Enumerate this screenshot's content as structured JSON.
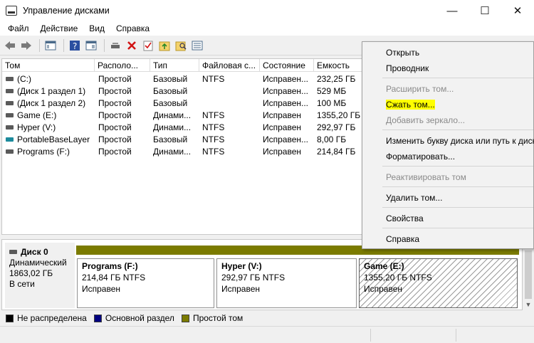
{
  "window": {
    "title": "Управление дисками",
    "minimize": "—",
    "maximize": "☐",
    "close": "✕"
  },
  "menu": [
    "Файл",
    "Действие",
    "Вид",
    "Справка"
  ],
  "table": {
    "headers": [
      "Том",
      "Располо...",
      "Тип",
      "Файловая с...",
      "Состояние",
      "Емкость"
    ],
    "rows": [
      {
        "name": "(C:)",
        "layout": "Простой",
        "type": "Базовый",
        "fs": "NTFS",
        "status": "Исправен...",
        "capacity": "232,25 ГБ",
        "icon": "drive-icon"
      },
      {
        "name": "(Диск 1 раздел 1)",
        "layout": "Простой",
        "type": "Базовый",
        "fs": "",
        "status": "Исправен...",
        "capacity": "529 МБ",
        "icon": "drive-icon"
      },
      {
        "name": "(Диск 1 раздел 2)",
        "layout": "Простой",
        "type": "Базовый",
        "fs": "",
        "status": "Исправен...",
        "capacity": "100 МБ",
        "icon": "drive-icon"
      },
      {
        "name": "Game (E:)",
        "layout": "Простой",
        "type": "Динами...",
        "fs": "NTFS",
        "status": "Исправен",
        "capacity": "1355,20 ГБ",
        "icon": "drive-icon"
      },
      {
        "name": "Hyper (V:)",
        "layout": "Простой",
        "type": "Динами...",
        "fs": "NTFS",
        "status": "Исправен",
        "capacity": "292,97 ГБ",
        "icon": "drive-icon"
      },
      {
        "name": "PortableBaseLayer",
        "layout": "Простой",
        "type": "Базовый",
        "fs": "NTFS",
        "status": "Исправен...",
        "capacity": "8,00 ГБ",
        "icon": "vhd-icon"
      },
      {
        "name": "Programs (F:)",
        "layout": "Простой",
        "type": "Динами...",
        "fs": "NTFS",
        "status": "Исправен",
        "capacity": "214,84 ГБ",
        "icon": "drive-icon"
      }
    ]
  },
  "context_menu": [
    {
      "label": "Открыть",
      "disabled": false
    },
    {
      "label": "Проводник",
      "disabled": false
    },
    {
      "label": "Расширить том...",
      "disabled": true
    },
    {
      "label": "Сжать том...",
      "disabled": false,
      "highlight": true
    },
    {
      "label": "Добавить зеркало...",
      "disabled": true
    },
    {
      "label": "Изменить букву диска или путь к диску...",
      "disabled": false
    },
    {
      "label": "Форматировать...",
      "disabled": false
    },
    {
      "label": "Реактивировать том",
      "disabled": true
    },
    {
      "label": "Удалить том...",
      "disabled": false
    },
    {
      "label": "Свойства",
      "disabled": false
    },
    {
      "label": "Справка",
      "disabled": false
    }
  ],
  "disk": {
    "name": "Диск 0",
    "type": "Динамический",
    "size": "1863,02 ГБ",
    "status": "В сети",
    "partitions": [
      {
        "name": "Programs  (F:)",
        "size": "214,84 ГБ NTFS",
        "status": "Исправен",
        "selected": false
      },
      {
        "name": "Hyper  (V:)",
        "size": "292,97 ГБ NTFS",
        "status": "Исправен",
        "selected": false
      },
      {
        "name": "Game  (E:)",
        "size": "1355,20 ГБ NTFS",
        "status": "Исправен",
        "selected": true
      }
    ]
  },
  "legend": [
    {
      "label": "Не распределена",
      "color": "#000000"
    },
    {
      "label": "Основной раздел",
      "color": "#000080"
    },
    {
      "label": "Простой том",
      "color": "#7b7b00"
    }
  ],
  "colors": {
    "simple_volume": "#7b7b00",
    "highlight": "#ffff00"
  }
}
